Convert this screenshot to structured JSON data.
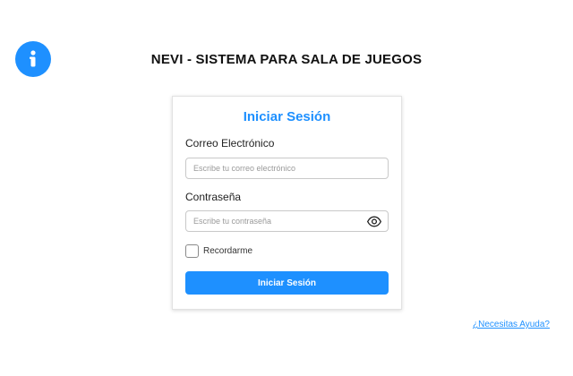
{
  "header": {
    "title": "NEVI - SISTEMA PARA SALA DE JUEGOS",
    "info_icon": "info-icon"
  },
  "login": {
    "title": "Iniciar Sesión",
    "email_label": "Correo Electrónico",
    "email_placeholder": "Escribe tu correo electrónico",
    "email_value": "",
    "password_label": "Contraseña",
    "password_placeholder": "Escribe tu contraseña",
    "password_value": "",
    "show_password_icon": "eye-icon",
    "remember_label": "Recordarme",
    "remember_checked": false,
    "submit_label": "Iniciar Sesión"
  },
  "footer": {
    "help_link": "¿Necesitas Ayuda?"
  },
  "colors": {
    "accent": "#1e90ff",
    "text": "#111111",
    "border": "#c9c9c9"
  }
}
